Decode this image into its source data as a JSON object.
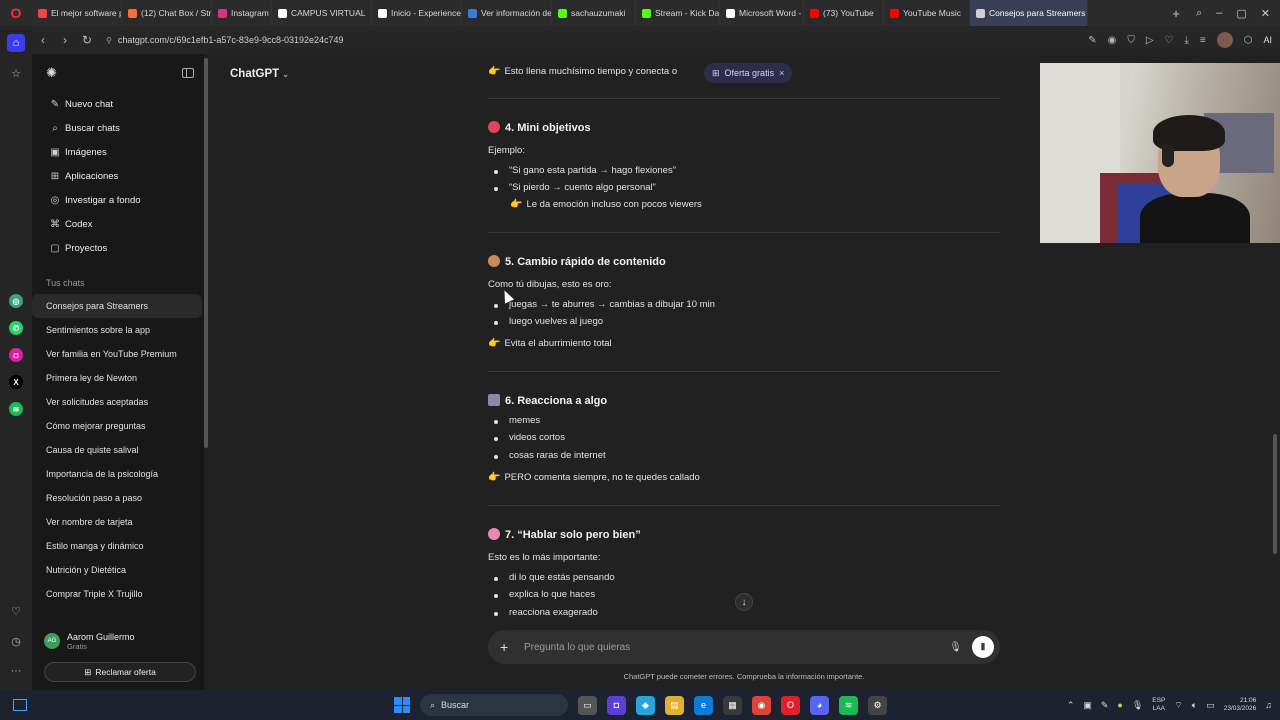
{
  "browser": {
    "tabs": [
      {
        "label": "El mejor software p",
        "color": "#e44"
      },
      {
        "label": "(12) Chat Box / Stre",
        "color": "#ff6a3d"
      },
      {
        "label": "Instagram",
        "color": "#d63384"
      },
      {
        "label": "CAMPUS VIRTUAL",
        "color": "#ffffff"
      },
      {
        "label": "Inicio - Experience",
        "color": "#ffffff"
      },
      {
        "label": "Ver información de",
        "color": "#3a7bd5"
      },
      {
        "label": "sachauzumaki",
        "color": "#53fc18"
      },
      {
        "label": "Stream - Kick Dash",
        "color": "#53fc18"
      },
      {
        "label": "Microsoft Word - M",
        "color": "#ffffff"
      },
      {
        "label": "(73) YouTube",
        "color": "#ff0000"
      },
      {
        "label": "YouTube Music",
        "color": "#ff0000"
      },
      {
        "label": "Consejos para Streamers",
        "color": "#cfcfcf",
        "active": true
      }
    ],
    "new_tab_icon": "plus-icon",
    "url": "chatgpt.com/c/69c1efb1-a57c-83e9-9cc8-03192e24c749",
    "ai_label": "AI"
  },
  "sidebar": {
    "menu": [
      {
        "icon": "✎",
        "icon_name": "new-chat-icon",
        "label": "Nuevo chat"
      },
      {
        "icon": "⌕",
        "icon_name": "search-icon",
        "label": "Buscar chats"
      },
      {
        "icon": "▣",
        "icon_name": "image-icon",
        "label": "Imágenes"
      },
      {
        "icon": "⊞",
        "icon_name": "apps-icon",
        "label": "Aplicaciones"
      },
      {
        "icon": "◎",
        "icon_name": "research-icon",
        "label": "Investigar a fondo"
      },
      {
        "icon": "⌘",
        "icon_name": "codex-icon",
        "label": "Codex"
      },
      {
        "icon": "▢",
        "icon_name": "folder-icon",
        "label": "Proyectos"
      }
    ],
    "chats_label": "Tus chats",
    "chats": [
      {
        "label": "Consejos para Streamers",
        "active": true
      },
      {
        "label": "Sentimientos sobre la app"
      },
      {
        "label": "Ver familia en YouTube Premium"
      },
      {
        "label": "Primera ley de Newton"
      },
      {
        "label": "Ver solicitudes aceptadas"
      },
      {
        "label": "Cómo mejorar preguntas"
      },
      {
        "label": "Causa de quiste salival"
      },
      {
        "label": "Importancia de la psicología"
      },
      {
        "label": "Resolución paso a paso"
      },
      {
        "label": "Ver nombre de tarjeta"
      },
      {
        "label": "Estilo manga y dinámico"
      },
      {
        "label": "Nutrición y Dietética"
      },
      {
        "label": "Comprar Triple X Trujillo"
      }
    ],
    "user": {
      "initials": "AG",
      "name": "Aarom Guillermo",
      "plan": "Gratis"
    },
    "claim_label": "Reclamar oferta"
  },
  "main": {
    "model": "ChatGPT",
    "offer_pill": "Oferta gratis",
    "prev_line": "Esto llena muchísimo tiempo y conecta o",
    "sections": {
      "s4": {
        "title": "4. Mini objetivos",
        "intro": "Ejemplo:",
        "bullets": [
          "“Si gano esta partida → hago flexiones”",
          "“Si pierdo → cuento algo personal”"
        ],
        "note": "Le da emoción incluso con pocos viewers"
      },
      "s5": {
        "title": "5. Cambio rápido de contenido",
        "intro": "Como tú dibujas, esto es oro:",
        "bullets": [
          "juegas → te aburres → cambias a dibujar 10 min",
          "luego vuelves al juego"
        ],
        "note": "Evita el aburrimiento total"
      },
      "s6": {
        "title": "6. Reacciona a algo",
        "bullets": [
          "memes",
          "videos cortos",
          "cosas raras de internet"
        ],
        "note": "PERO comenta siempre, no te quedes callado"
      },
      "s7": {
        "title": "7. “Hablar solo pero bien”",
        "intro": "Esto es lo más importante:",
        "bullets": [
          "di lo que estás pensando",
          "explica lo que haces",
          "reacciona exagerado"
        ]
      }
    },
    "composer_placeholder": "Pregunta lo que quieras",
    "disclaimer": "ChatGPT puede cometer errores. Comprueba la información importante."
  },
  "taskbar": {
    "search_label": "Buscar",
    "lang": "ESP",
    "lang2": "LAA",
    "time": "21:06",
    "date": "23/03/2026"
  }
}
